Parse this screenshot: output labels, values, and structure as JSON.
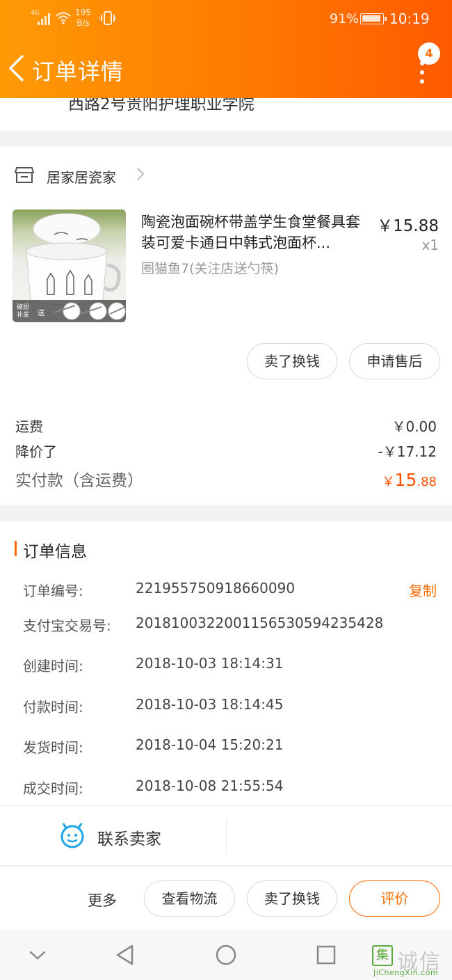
{
  "status_bar": {
    "network_type": "4G",
    "speed_value": "195",
    "speed_unit": "B/s",
    "battery": "91%",
    "time": "10:19"
  },
  "header": {
    "title": "订单详情",
    "message_count": "4",
    "back_icon": "chevron-left-icon",
    "more_icon": "more-vertical-icon",
    "gradient": [
      "#ff9a05",
      "#ff5a00"
    ]
  },
  "address": {
    "tail_text": "西路2号贵阳护理职业学院"
  },
  "shop": {
    "name": "居家居瓷家",
    "icon": "store-icon"
  },
  "product": {
    "name": "陶瓷泡面碗杯带盖学生食堂餐具套装可爱卡通日中韩式泡面杯...",
    "sku": "圈猫鱼7(关注店送勺筷)",
    "price": "￥15.88",
    "qty": "x1",
    "thumb_badge": "破损补发",
    "thumb_gift": "送"
  },
  "item_buttons": {
    "sell": "卖了换钱",
    "after_sale": "申请售后"
  },
  "summary": {
    "shipping_label": "运费",
    "shipping_value": "￥0.00",
    "discount_label": "降价了",
    "discount_value": "-￥17.12",
    "paid_label": "实付款（含运费）",
    "paid_currency": "￥",
    "paid_integer": "15",
    "paid_decimal": ".88"
  },
  "order_info": {
    "title": "订单信息",
    "copy_label": "复制",
    "rows": [
      {
        "label": "订单编号:",
        "value": "221955750918660090"
      },
      {
        "label": "支付宝交易号:",
        "value": "2018100322001156530594235428"
      },
      {
        "label": "创建时间:",
        "value": "2018-10-03 18:14:31"
      },
      {
        "label": "付款时间:",
        "value": "2018-10-03 18:14:45"
      },
      {
        "label": "发货时间:",
        "value": "2018-10-04 15:20:21"
      },
      {
        "label": "成交时间:",
        "value": "2018-10-08 21:55:54"
      }
    ]
  },
  "contact": {
    "label": "联系卖家",
    "icon": "chat-face-icon"
  },
  "actions": {
    "more": "更多",
    "logistics": "查看物流",
    "sell": "卖了换钱",
    "review": "评价"
  },
  "watermark": {
    "icon_char": "集",
    "text": "诚信",
    "url": "JiChengXin.com"
  },
  "colors": {
    "accent": "#ff6a00",
    "price": "#ff5000"
  }
}
